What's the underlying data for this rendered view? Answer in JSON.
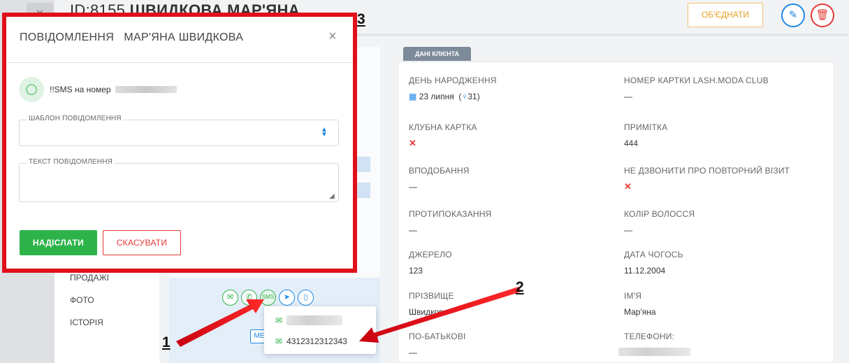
{
  "header": {
    "id_text": "ID:8155",
    "client_name": "ШВИДКОВА МАР'ЯНА",
    "merge_button": "ОБ'ЄДНАТИ",
    "close_glyph": "×"
  },
  "left_nav": {
    "items": [
      "ПРОДАЖІ",
      "ФОТО",
      "ІСТОРІЯ"
    ]
  },
  "profile": {
    "contact_icons": [
      "envelope-icon",
      "phone-icon",
      "sms-icon",
      "telegram-icon",
      "mobile-icon"
    ],
    "sms_label": "SMS",
    "me_button": "МЕ",
    "dropdown": {
      "items": [
        {
          "value": ""
        },
        {
          "value": "4312312312343"
        }
      ]
    }
  },
  "info": {
    "tab_label": "ДАНІ КЛІЄНТА",
    "birthday_label": "ДЕНЬ НАРОДЖЕННЯ",
    "birthday_value": "23 липня",
    "age_value": "31",
    "card_label": "НОМЕР КАРТКИ LASH.MODA CLUB",
    "card_value": "—",
    "club_label": "КЛУБНА КАРТКА",
    "note_label": "ПРИМІТКА",
    "note_value": "444",
    "likes_label": "ВПОДОБАННЯ",
    "likes_value": "—",
    "dont_call_label": "НЕ ДЗВОНИТИ ПРО ПОВТОРНИЙ ВІЗИТ",
    "contra_label": "ПРОТИПОКАЗАННЯ",
    "contra_value": "—",
    "hair_label": "КОЛІР ВОЛОССЯ",
    "hair_value": "—",
    "source_label": "ДЖЕРЕЛО",
    "source_value": "123",
    "date_label": "ДАТА ЧОГОСЬ",
    "date_value": "11.12.2004",
    "surname_label": "ПРІЗВИЩЕ",
    "surname_value": "Швидкова",
    "firstname_label": "ІМ'Я",
    "firstname_value": "Мар'яна",
    "patronymic_label": "ПО-БАТЬКОВІ",
    "patronymic_value": "—",
    "phones_label": "ТЕЛЕФОНИ:"
  },
  "modal": {
    "title_prefix": "ПОВІДОМЛЕННЯ",
    "title_name": "МАР'ЯНА ШВИДКОВА",
    "close_glyph": "×",
    "sms_prefix": "!!SMS на номер",
    "template_legend": "ШАБЛОН ПОВІДОМЛЕННЯ",
    "template_value": "",
    "text_legend": "ТЕКСТ ПОВІДОМЛЕННЯ",
    "text_value": "",
    "send_button": "НАДІСЛАТИ",
    "cancel_button": "СКАСУВАТИ"
  },
  "annotations": {
    "callout_1": "1",
    "callout_2": "2",
    "callout_3": "3"
  },
  "colors": {
    "accent_green": "#2db34a",
    "accent_blue": "#1e88e5",
    "danger_red": "#e53935",
    "highlight_red": "#e0101a",
    "merge_orange": "#e8a020"
  }
}
